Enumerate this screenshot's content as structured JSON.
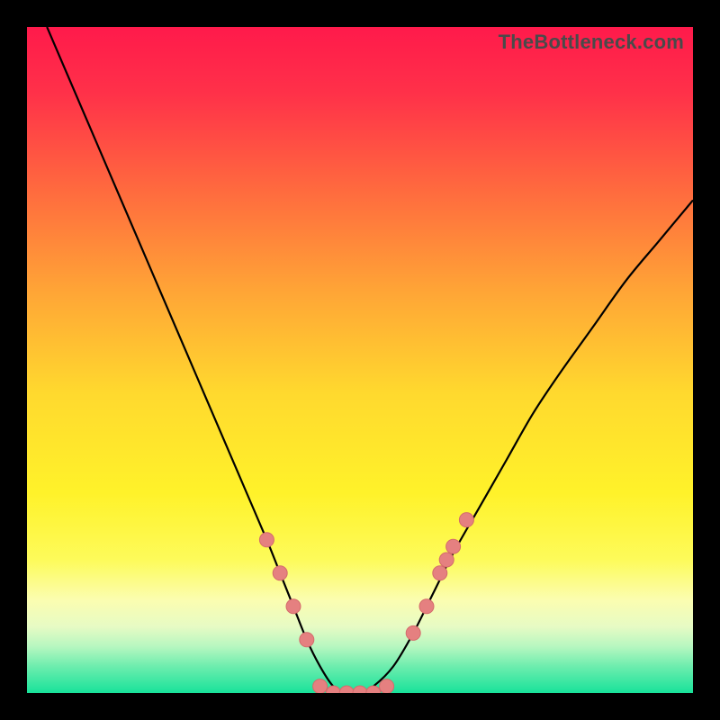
{
  "watermark": "TheBottleneck.com",
  "colors": {
    "black": "#000000",
    "curve": "#000000",
    "marker_fill": "#e58080",
    "marker_stroke": "#d46b6b"
  },
  "chart_data": {
    "type": "line",
    "title": "",
    "xlabel": "",
    "ylabel": "",
    "xlim": [
      0,
      100
    ],
    "ylim": [
      0,
      100
    ],
    "grid": false,
    "legend": false,
    "background_gradient": {
      "stops": [
        {
          "pos": 0.0,
          "color": "#ff1a4b"
        },
        {
          "pos": 0.1,
          "color": "#ff3149"
        },
        {
          "pos": 0.25,
          "color": "#ff6c3e"
        },
        {
          "pos": 0.4,
          "color": "#ffa636"
        },
        {
          "pos": 0.55,
          "color": "#ffd92e"
        },
        {
          "pos": 0.7,
          "color": "#fff22a"
        },
        {
          "pos": 0.8,
          "color": "#fdfb5a"
        },
        {
          "pos": 0.86,
          "color": "#fbfdb0"
        },
        {
          "pos": 0.9,
          "color": "#e7fbc4"
        },
        {
          "pos": 0.93,
          "color": "#b7f7c0"
        },
        {
          "pos": 0.96,
          "color": "#6dedae"
        },
        {
          "pos": 1.0,
          "color": "#18e29a"
        }
      ]
    },
    "series": [
      {
        "name": "bottleneck-curve",
        "x": [
          3,
          6,
          9,
          12,
          15,
          18,
          21,
          24,
          27,
          30,
          33,
          36,
          38,
          40,
          42,
          44,
          46,
          48,
          50,
          52,
          55,
          58,
          61,
          64,
          68,
          72,
          76,
          80,
          85,
          90,
          95,
          100
        ],
        "y": [
          100,
          93,
          86,
          79,
          72,
          65,
          58,
          51,
          44,
          37,
          30,
          23,
          18,
          13,
          8,
          4,
          1,
          0,
          0,
          1,
          4,
          9,
          15,
          21,
          28,
          35,
          42,
          48,
          55,
          62,
          68,
          74
        ]
      }
    ],
    "markers": {
      "name": "highlight-points",
      "points": [
        {
          "x": 36,
          "y": 23
        },
        {
          "x": 38,
          "y": 18
        },
        {
          "x": 40,
          "y": 13
        },
        {
          "x": 42,
          "y": 8
        },
        {
          "x": 44,
          "y": 1
        },
        {
          "x": 46,
          "y": 0
        },
        {
          "x": 48,
          "y": 0
        },
        {
          "x": 50,
          "y": 0
        },
        {
          "x": 52,
          "y": 0
        },
        {
          "x": 54,
          "y": 1
        },
        {
          "x": 58,
          "y": 9
        },
        {
          "x": 60,
          "y": 13
        },
        {
          "x": 62,
          "y": 18
        },
        {
          "x": 63,
          "y": 20
        },
        {
          "x": 64,
          "y": 22
        },
        {
          "x": 66,
          "y": 26
        }
      ],
      "radius": 8
    }
  }
}
